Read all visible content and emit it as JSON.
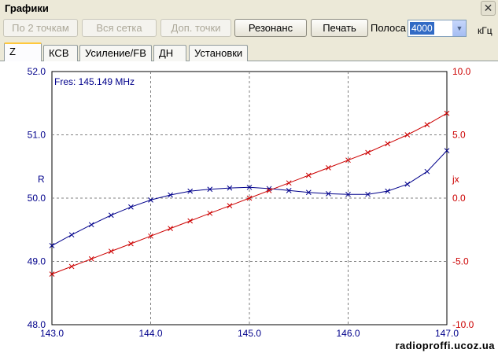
{
  "window": {
    "title": "Графики",
    "close_glyph": "✕"
  },
  "toolbar": {
    "btn_2points": "По 2 точкам",
    "btn_all_grid": "Вся сетка",
    "btn_extra_points": "Доп. точки",
    "btn_resonance": "Резонанс",
    "btn_print": "Печать",
    "band_label": "Полоса",
    "band_value": "4000",
    "band_unit": "кГц"
  },
  "tabs": [
    {
      "label": "Z",
      "active": true
    },
    {
      "label": "КСВ",
      "active": false
    },
    {
      "label": "Усиление/FB",
      "active": false
    },
    {
      "label": "ДН",
      "active": false
    },
    {
      "label": "Установки",
      "active": false
    }
  ],
  "watermark": "radioproffi.ucoz.ua",
  "chart_data": {
    "type": "line",
    "annotation": "Fres: 145.149 MHz",
    "left_axis_label": "R",
    "right_axis_label": "jx",
    "xlim": [
      143.0,
      147.0
    ],
    "x_ticks": [
      "143.0",
      "144.0",
      "145.0",
      "146.0",
      "147.0"
    ],
    "left_ylim": [
      48.0,
      52.0
    ],
    "left_ticks": [
      "48.0",
      "49.0",
      "50.0",
      "51.0",
      "52.0"
    ],
    "right_ylim": [
      -10.0,
      10.0
    ],
    "right_ticks": [
      "-10.0",
      "-5.0",
      "0.0",
      "5.0",
      "10.0"
    ],
    "grid": true,
    "colors": {
      "R": "#00008b",
      "jx": "#cc0000",
      "left_axis": "#00008b",
      "right_axis": "#cc0000"
    },
    "x": [
      143.0,
      143.2,
      143.4,
      143.6,
      143.8,
      144.0,
      144.2,
      144.4,
      144.6,
      144.8,
      145.0,
      145.2,
      145.4,
      145.6,
      145.8,
      146.0,
      146.2,
      146.4,
      146.6,
      146.8,
      147.0
    ],
    "series": [
      {
        "name": "R",
        "axis": "left",
        "values": [
          49.25,
          49.42,
          49.58,
          49.73,
          49.86,
          49.97,
          50.05,
          50.11,
          50.14,
          50.16,
          50.17,
          50.15,
          50.12,
          50.09,
          50.07,
          50.06,
          50.06,
          50.11,
          50.22,
          50.42,
          50.75
        ]
      },
      {
        "name": "jx",
        "axis": "right",
        "values": [
          -6.0,
          -5.4,
          -4.8,
          -4.2,
          -3.6,
          -3.0,
          -2.4,
          -1.8,
          -1.2,
          -0.6,
          0.0,
          0.6,
          1.2,
          1.8,
          2.4,
          3.0,
          3.6,
          4.3,
          5.0,
          5.8,
          6.7
        ]
      }
    ]
  }
}
